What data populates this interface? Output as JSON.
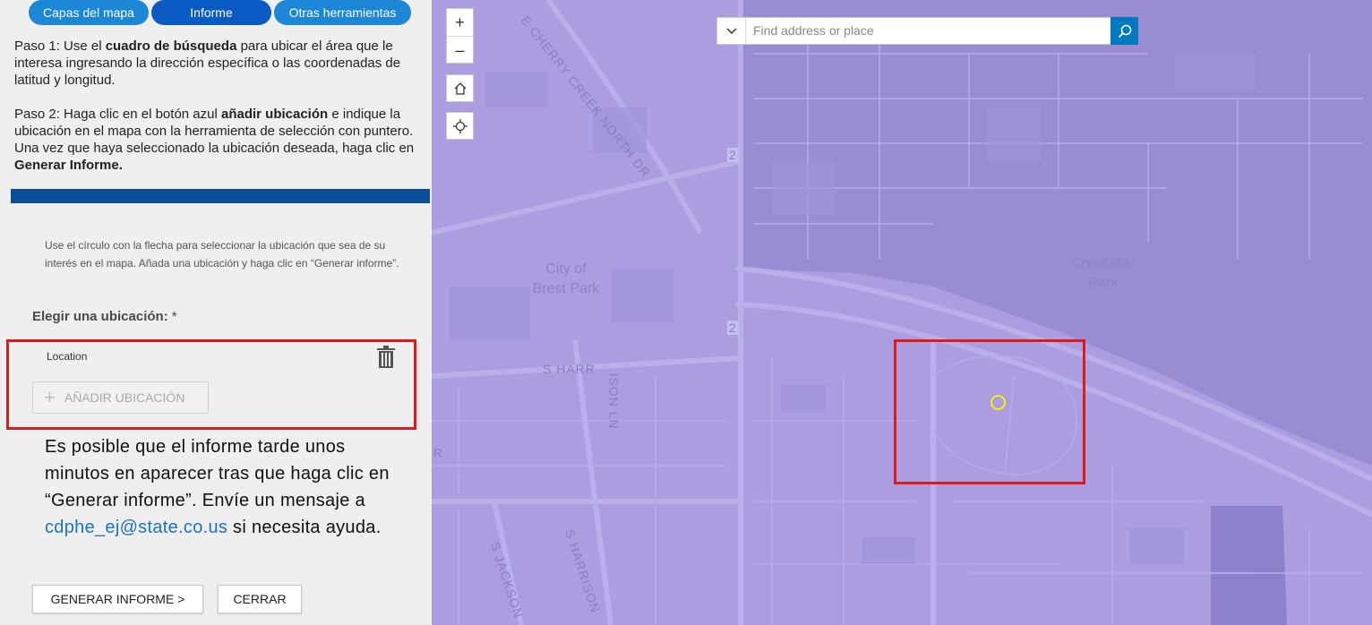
{
  "tabs": [
    {
      "label": "Capas del mapa",
      "active": false
    },
    {
      "label": "Informe",
      "active": true
    },
    {
      "label": "Otras herramientas",
      "active": false
    }
  ],
  "step1": {
    "prefix": "Paso 1:  Use el ",
    "bold": "cuadro de búsqueda",
    "suffix": " para ubicar el área que le interesa ingresando la dirección específica o las coordenadas de latitud y longitud."
  },
  "step2": {
    "prefix": "Paso 2:  Haga clic en el botón azul ",
    "bold1": "añadir ubicación",
    "middle": " e indique la ubicación en el mapa con la herramienta de selección con puntero. Una vez que haya seleccionado la ubicación deseada, haga clic en ",
    "bold2": "Generar Informe."
  },
  "form": {
    "hint": "Use el círculo con la flecha para seleccionar la ubicación que sea de su interés en el mapa. Añada una ubicación y haga clic en “Generar informe”.",
    "choose_label": "Elegir una ubicación:",
    "required_mark": "*",
    "location_label": "Location",
    "add_button": "AÑADIR UBICACIÓN"
  },
  "note": {
    "text_before": "Es posible que el informe tarde unos minutos en aparecer tras que haga clic en “Generar informe”. Envíe un mensaje a ",
    "email": "cdphe_ej@state.co.us",
    "text_after": " si necesita ayuda."
  },
  "buttons": {
    "generate": "GENERAR INFORME >",
    "close": "CERRAR"
  },
  "map": {
    "zoom_in": "+",
    "zoom_out": "–",
    "search_placeholder": "Find address or place",
    "labels": {
      "city_park": "City of\nBrest Park",
      "creekside_park": "Creekside\nPark",
      "cherry_creek": "E CHERRY CREEK NORTH DR",
      "s_harrison_1": "S HARR",
      "s_harrison_2": "ISON LN",
      "s_harrison_3": "S HARRISON",
      "s_jackson": "S JACKSON",
      "route_2a": "2",
      "route_2b": "2",
      "r_edge": "R"
    },
    "colors": {
      "overlay": "#ab9de0",
      "dark_overlay": "#9a8cd3",
      "highlight": "#e01818",
      "pin": "#f4f00a"
    }
  }
}
